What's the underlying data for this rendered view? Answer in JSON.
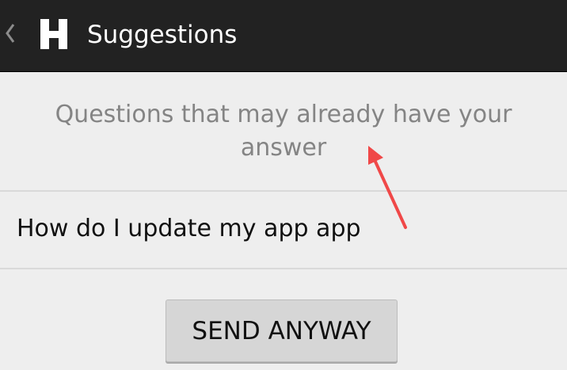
{
  "action_bar": {
    "title": "Suggestions",
    "back_icon": "chevron-left-icon",
    "logo_icon": "h-logo-icon",
    "background": "#222222"
  },
  "suggestions": {
    "header": "Questions that may already have your answer",
    "items": [
      {
        "text": "How do I update my app app"
      }
    ]
  },
  "actions": {
    "send_anyway_label": "SEND ANYWAY"
  },
  "annotation": {
    "arrow_color": "#f04848"
  }
}
